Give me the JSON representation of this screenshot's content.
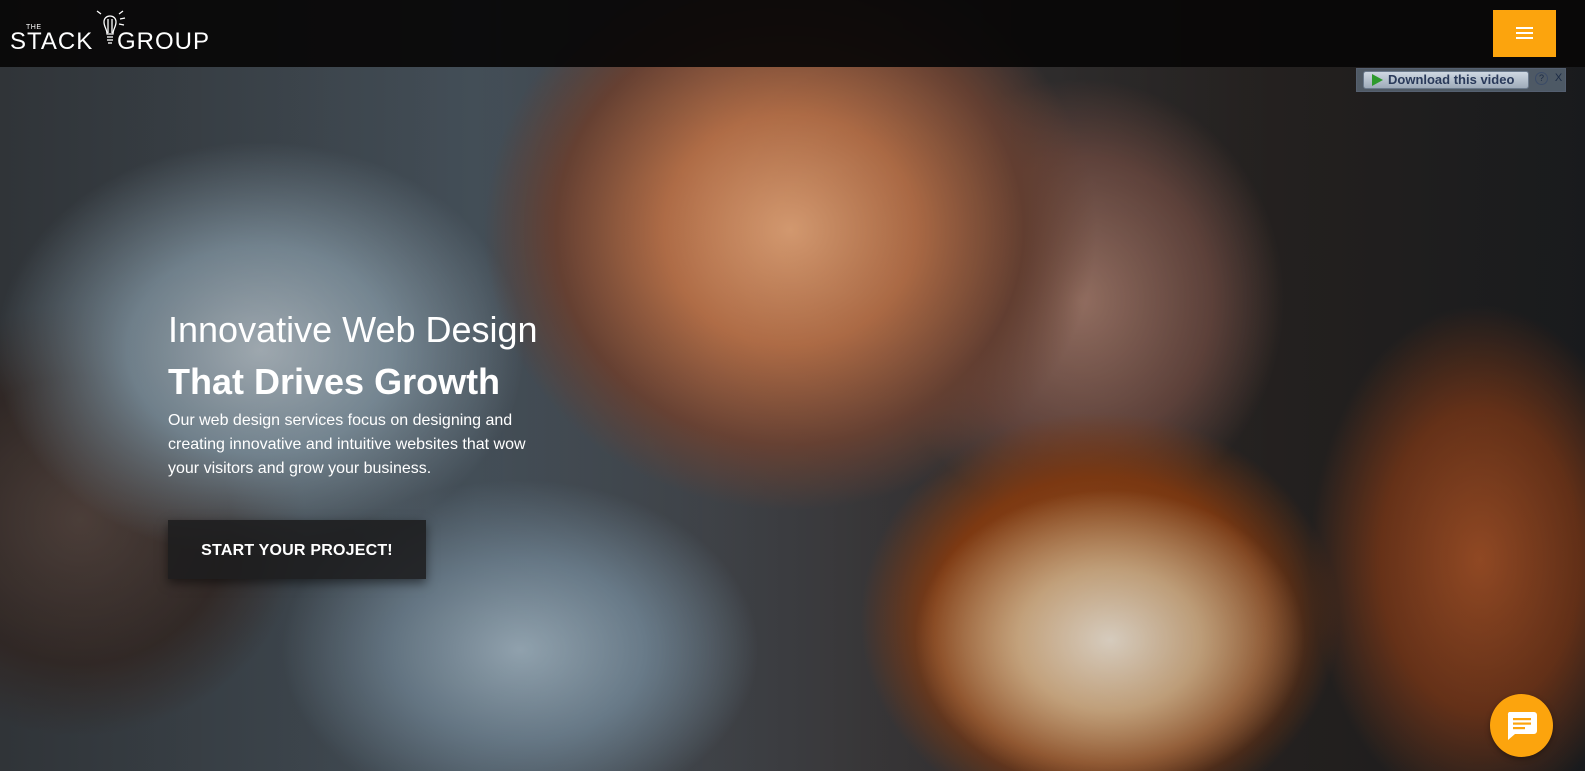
{
  "header": {
    "logo": {
      "the": "THE",
      "stack": "STACK",
      "group": "GROUP"
    },
    "menu_icon": "hamburger-menu-icon",
    "accent_color": "#fca40d"
  },
  "video_plugin": {
    "download_label": "Download this video",
    "help_label": "?",
    "close_label": "X"
  },
  "hero": {
    "title_line1": "Innovative Web Design",
    "title_line2": "That Drives Growth",
    "description": "Our web design services focus on designing and creating innovative and intuitive websites that wow your visitors and grow your business.",
    "cta_label": "START YOUR PROJECT!"
  },
  "chat": {
    "icon": "chat-bubble-icon",
    "color": "#fca40d"
  }
}
